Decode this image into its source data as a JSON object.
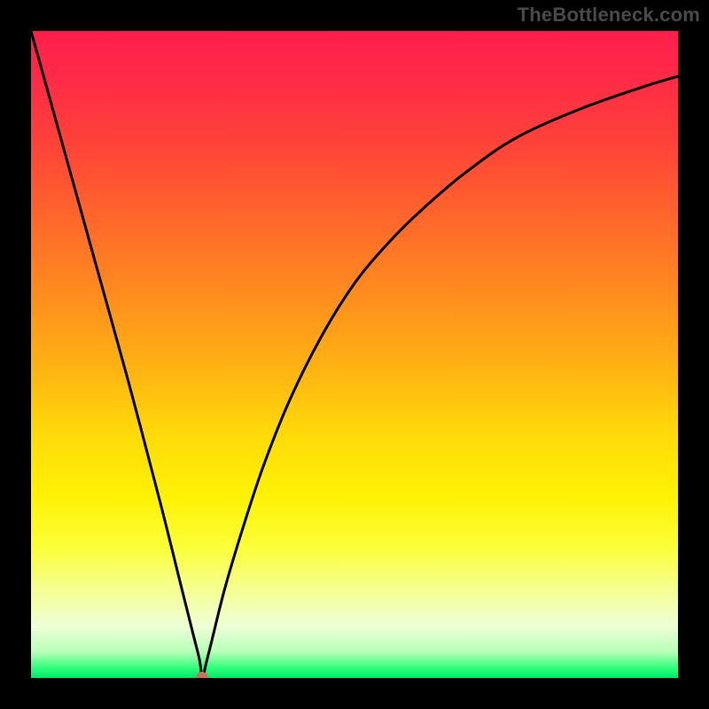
{
  "watermark": "TheBottleneck.com",
  "chart_data": {
    "type": "line",
    "title": "",
    "xlabel": "",
    "ylabel": "",
    "xlim": [
      0,
      100
    ],
    "ylim": [
      0,
      100
    ],
    "grid": false,
    "legend": false,
    "background_gradient": {
      "orientation": "vertical",
      "stops": [
        {
          "pos": 0.0,
          "color": "#ff1e4b"
        },
        {
          "pos": 0.3,
          "color": "#ff6a2a"
        },
        {
          "pos": 0.6,
          "color": "#ffd90a"
        },
        {
          "pos": 0.86,
          "color": "#f6ff8e"
        },
        {
          "pos": 0.97,
          "color": "#2dff7a"
        },
        {
          "pos": 1.0,
          "color": "#00e86b"
        }
      ]
    },
    "series": [
      {
        "name": "bottleneck-curve",
        "color": "#000000",
        "x": [
          0,
          5,
          10,
          15,
          20,
          23,
          25,
          26,
          26.5,
          27,
          28,
          30,
          33,
          36,
          40,
          45,
          50,
          55,
          60,
          67,
          75,
          85,
          95,
          100
        ],
        "values": [
          100,
          82,
          64,
          46,
          27,
          15,
          7,
          3,
          0,
          2,
          6,
          14,
          24,
          33,
          43,
          53,
          61,
          67,
          72,
          78,
          83.5,
          88,
          91.5,
          93
        ]
      }
    ],
    "minimum_marker": {
      "x": 26.5,
      "y": 0,
      "color": "#c97264"
    }
  }
}
